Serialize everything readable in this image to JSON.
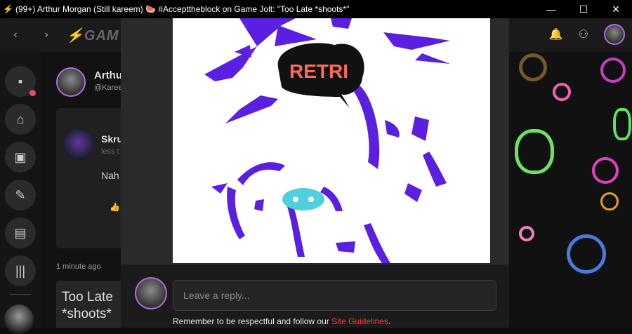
{
  "window": {
    "app_icon": "gamejolt-bolt-icon",
    "title": "(99+) Arthur Morgan (Still kareem) 🍉 #Accepttheblock on Game Jolt: \"Too Late *shoots*\"",
    "controls": {
      "minimize": "—",
      "maximize": "☐",
      "close": "✕"
    }
  },
  "nav": {
    "back": "‹",
    "forward": "›",
    "logo": "⚡GAM",
    "bell_icon": "🔔",
    "people_icon": "⚇"
  },
  "sidebar": {
    "items": [
      {
        "icon": "feed-icon",
        "glyph": "▪"
      },
      {
        "icon": "store-icon",
        "glyph": "⌂"
      },
      {
        "icon": "backpack-icon",
        "glyph": "▣"
      },
      {
        "icon": "quill-icon",
        "glyph": "✎"
      },
      {
        "icon": "chat-icon",
        "glyph": "▤"
      },
      {
        "icon": "library-icon",
        "glyph": "|||"
      }
    ]
  },
  "feed": {
    "post_name": "Arthu",
    "post_handle": "@Kareem",
    "comment_name": "Skru",
    "comment_time": "less t",
    "comment_text": "Nah",
    "like_icon": "👍",
    "time": "1 minute ago",
    "post_title": "Too Late *shoots*"
  },
  "image": {
    "sign_text": "RETRI",
    "colors": {
      "stroke": "#5a1fe0",
      "nose": "#4fd0e0",
      "sign": "#ff6a55"
    }
  },
  "reply": {
    "placeholder": "Leave a reply...",
    "guidelines_prefix": "Remember to be respectful and follow our ",
    "guidelines_link": "Site Guidelines",
    "guidelines_suffix": "."
  }
}
